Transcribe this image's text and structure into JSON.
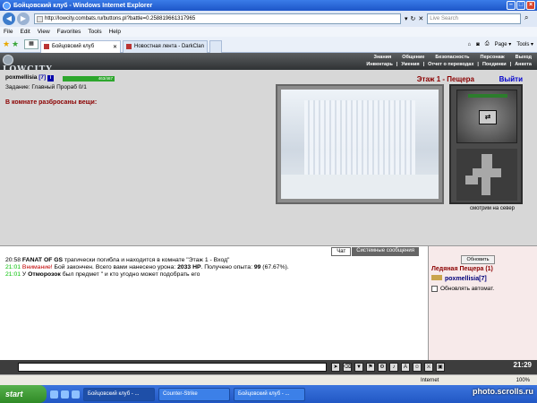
{
  "window": {
    "title": "Бойцовский клуб - Windows Internet Explorer",
    "address": "http://lowcity.combats.ru/buttons.pl?battle=0.258819661317965",
    "search_placeholder": "Live Search"
  },
  "menu": [
    "File",
    "Edit",
    "View",
    "Favorites",
    "Tools",
    "Help"
  ],
  "tabs": [
    {
      "label": "Бойцовский клуб",
      "active": true
    },
    {
      "label": "Новостная лента - DarkClan",
      "active": false
    }
  ],
  "commandbar": {
    "page": "Page ▾",
    "tools": "Tools ▾"
  },
  "game": {
    "logo": "LOWCITY",
    "nav_top": [
      "Знания",
      "Общение",
      "Безопасность",
      "Персонаж",
      "Выход"
    ],
    "nav_bottom": [
      "Инвентарь",
      "Умения",
      "Отчет о переводах",
      "Поединки",
      "Анкета"
    ],
    "user": {
      "name": "poxmellisia",
      "level": "[7]",
      "info_icon": "i",
      "hp": "463/467",
      "task": "Задание: Главный Прораб 0/1"
    },
    "items_message": "В комнате разбросаны вещи:",
    "floor": "Этаж 1 - Пещера",
    "exit": "Выйти",
    "looking": "смотрим на север"
  },
  "chat": {
    "tabs": [
      "Чат",
      "Системные сообщения"
    ],
    "lines": [
      {
        "time": "20:58",
        "parts": [
          {
            "text": "FANAT OF GS",
            "bold": true
          },
          {
            "text": " трагически погибла и находится в комнате \"Этаж 1 - Вход\""
          }
        ]
      },
      {
        "time": "21:01",
        "highlight": true,
        "parts": [
          {
            "text": "Внимание!",
            "red": true
          },
          {
            "text": " Бой закончен. Всего вами нанесено урона: "
          },
          {
            "text": "2033 HP",
            "bold": true
          },
          {
            "text": ". Получено опыта: "
          },
          {
            "text": "99",
            "bold": true
          },
          {
            "text": " (67.67%)."
          }
        ]
      },
      {
        "time": "21:01",
        "highlight": true,
        "parts": [
          {
            "text": "У "
          },
          {
            "text": "Отморозок",
            "bold": true
          },
          {
            "text": " был предмет \" и кто угодно может подобрать его"
          }
        ]
      }
    ]
  },
  "sidebar": {
    "refresh": "Обновить",
    "location": "Ледяная Пещера (1)",
    "player_name": "poxmellisia",
    "player_level": "[7]",
    "auto_refresh": "Обновлять автомат."
  },
  "clock": "21:29",
  "status": {
    "zone": "Internet",
    "zoom": "100%"
  },
  "taskbar": {
    "start": "start",
    "buttons": [
      "Бойцовский клуб - ...",
      "Counter-Strike",
      "Бойцовский клуб - ..."
    ]
  },
  "watermark": "photo.scrolls.ru"
}
